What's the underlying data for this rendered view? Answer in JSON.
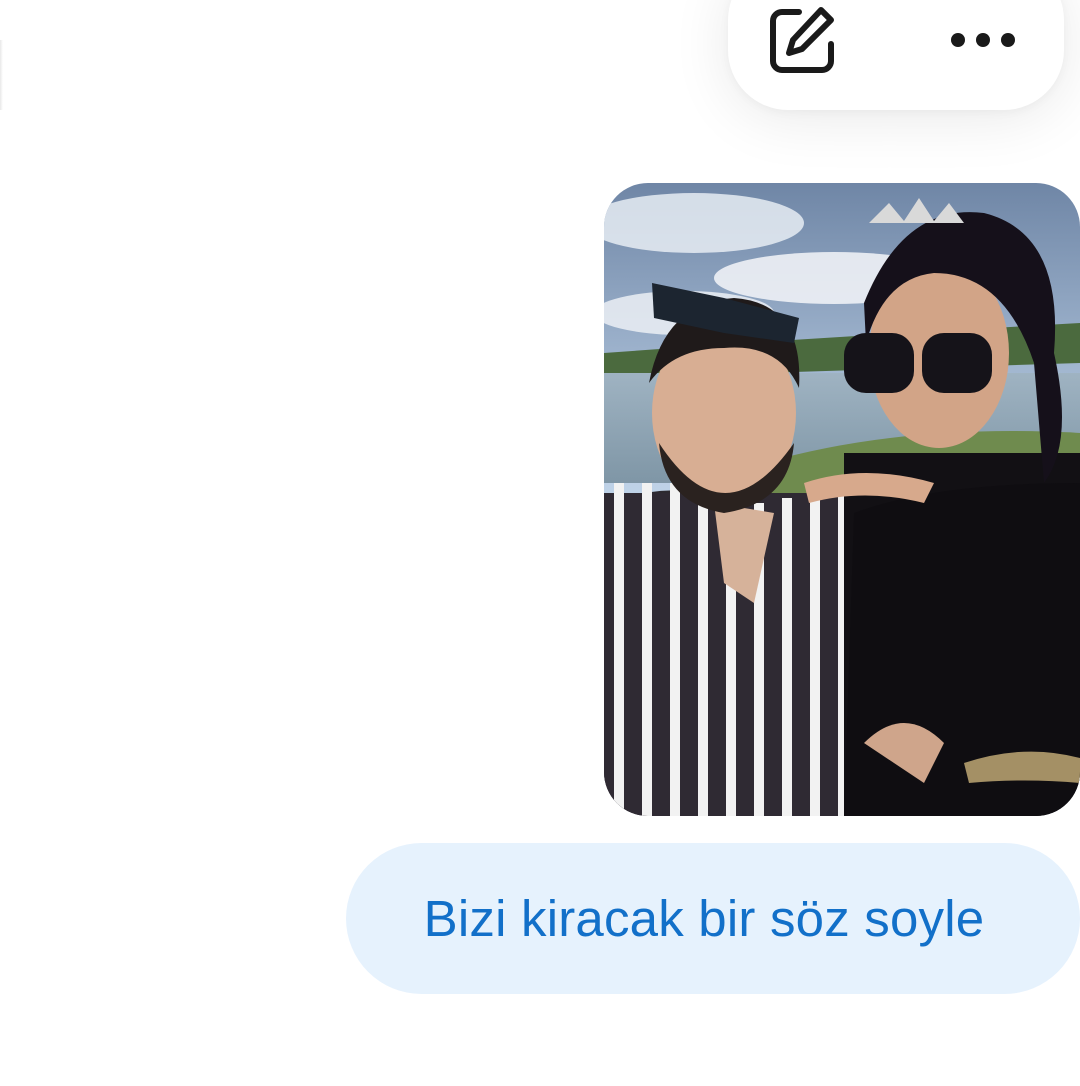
{
  "toolbar": {
    "edit_icon": "edit-pencil-square-icon",
    "more_icon": "more-horizontal-dots-icon"
  },
  "messages": [
    {
      "type": "image",
      "icon": "photo-couple-selfie"
    },
    {
      "type": "text",
      "text": "Bizi kiracak bir söz soyle"
    }
  ],
  "colors": {
    "bubble_background": "#e6f2fd",
    "bubble_text": "#1270c9",
    "icon": "#1a1a1a"
  }
}
